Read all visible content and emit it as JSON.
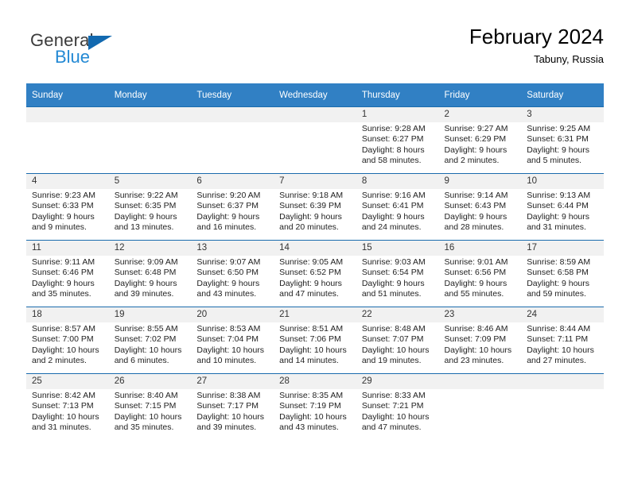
{
  "brand": {
    "name_part1": "General",
    "name_part2": "Blue",
    "triangle_color": "#1269b0",
    "blue_color": "#2389d4"
  },
  "header": {
    "title": "February 2024",
    "subtitle": "Tabuny, Russia"
  },
  "theme": {
    "header_blue": "#3180c4",
    "separator_blue": "#1a6bad",
    "daynum_band": "#f1f1f1"
  },
  "columns": [
    "Sunday",
    "Monday",
    "Tuesday",
    "Wednesday",
    "Thursday",
    "Friday",
    "Saturday"
  ],
  "weeks": [
    [
      {
        "day": "",
        "lines": []
      },
      {
        "day": "",
        "lines": []
      },
      {
        "day": "",
        "lines": []
      },
      {
        "day": "",
        "lines": []
      },
      {
        "day": "1",
        "lines": [
          "Sunrise: 9:28 AM",
          "Sunset: 6:27 PM",
          "Daylight: 8 hours",
          "and 58 minutes."
        ]
      },
      {
        "day": "2",
        "lines": [
          "Sunrise: 9:27 AM",
          "Sunset: 6:29 PM",
          "Daylight: 9 hours",
          "and 2 minutes."
        ]
      },
      {
        "day": "3",
        "lines": [
          "Sunrise: 9:25 AM",
          "Sunset: 6:31 PM",
          "Daylight: 9 hours",
          "and 5 minutes."
        ]
      }
    ],
    [
      {
        "day": "4",
        "lines": [
          "Sunrise: 9:23 AM",
          "Sunset: 6:33 PM",
          "Daylight: 9 hours",
          "and 9 minutes."
        ]
      },
      {
        "day": "5",
        "lines": [
          "Sunrise: 9:22 AM",
          "Sunset: 6:35 PM",
          "Daylight: 9 hours",
          "and 13 minutes."
        ]
      },
      {
        "day": "6",
        "lines": [
          "Sunrise: 9:20 AM",
          "Sunset: 6:37 PM",
          "Daylight: 9 hours",
          "and 16 minutes."
        ]
      },
      {
        "day": "7",
        "lines": [
          "Sunrise: 9:18 AM",
          "Sunset: 6:39 PM",
          "Daylight: 9 hours",
          "and 20 minutes."
        ]
      },
      {
        "day": "8",
        "lines": [
          "Sunrise: 9:16 AM",
          "Sunset: 6:41 PM",
          "Daylight: 9 hours",
          "and 24 minutes."
        ]
      },
      {
        "day": "9",
        "lines": [
          "Sunrise: 9:14 AM",
          "Sunset: 6:43 PM",
          "Daylight: 9 hours",
          "and 28 minutes."
        ]
      },
      {
        "day": "10",
        "lines": [
          "Sunrise: 9:13 AM",
          "Sunset: 6:44 PM",
          "Daylight: 9 hours",
          "and 31 minutes."
        ]
      }
    ],
    [
      {
        "day": "11",
        "lines": [
          "Sunrise: 9:11 AM",
          "Sunset: 6:46 PM",
          "Daylight: 9 hours",
          "and 35 minutes."
        ]
      },
      {
        "day": "12",
        "lines": [
          "Sunrise: 9:09 AM",
          "Sunset: 6:48 PM",
          "Daylight: 9 hours",
          "and 39 minutes."
        ]
      },
      {
        "day": "13",
        "lines": [
          "Sunrise: 9:07 AM",
          "Sunset: 6:50 PM",
          "Daylight: 9 hours",
          "and 43 minutes."
        ]
      },
      {
        "day": "14",
        "lines": [
          "Sunrise: 9:05 AM",
          "Sunset: 6:52 PM",
          "Daylight: 9 hours",
          "and 47 minutes."
        ]
      },
      {
        "day": "15",
        "lines": [
          "Sunrise: 9:03 AM",
          "Sunset: 6:54 PM",
          "Daylight: 9 hours",
          "and 51 minutes."
        ]
      },
      {
        "day": "16",
        "lines": [
          "Sunrise: 9:01 AM",
          "Sunset: 6:56 PM",
          "Daylight: 9 hours",
          "and 55 minutes."
        ]
      },
      {
        "day": "17",
        "lines": [
          "Sunrise: 8:59 AM",
          "Sunset: 6:58 PM",
          "Daylight: 9 hours",
          "and 59 minutes."
        ]
      }
    ],
    [
      {
        "day": "18",
        "lines": [
          "Sunrise: 8:57 AM",
          "Sunset: 7:00 PM",
          "Daylight: 10 hours",
          "and 2 minutes."
        ]
      },
      {
        "day": "19",
        "lines": [
          "Sunrise: 8:55 AM",
          "Sunset: 7:02 PM",
          "Daylight: 10 hours",
          "and 6 minutes."
        ]
      },
      {
        "day": "20",
        "lines": [
          "Sunrise: 8:53 AM",
          "Sunset: 7:04 PM",
          "Daylight: 10 hours",
          "and 10 minutes."
        ]
      },
      {
        "day": "21",
        "lines": [
          "Sunrise: 8:51 AM",
          "Sunset: 7:06 PM",
          "Daylight: 10 hours",
          "and 14 minutes."
        ]
      },
      {
        "day": "22",
        "lines": [
          "Sunrise: 8:48 AM",
          "Sunset: 7:07 PM",
          "Daylight: 10 hours",
          "and 19 minutes."
        ]
      },
      {
        "day": "23",
        "lines": [
          "Sunrise: 8:46 AM",
          "Sunset: 7:09 PM",
          "Daylight: 10 hours",
          "and 23 minutes."
        ]
      },
      {
        "day": "24",
        "lines": [
          "Sunrise: 8:44 AM",
          "Sunset: 7:11 PM",
          "Daylight: 10 hours",
          "and 27 minutes."
        ]
      }
    ],
    [
      {
        "day": "25",
        "lines": [
          "Sunrise: 8:42 AM",
          "Sunset: 7:13 PM",
          "Daylight: 10 hours",
          "and 31 minutes."
        ]
      },
      {
        "day": "26",
        "lines": [
          "Sunrise: 8:40 AM",
          "Sunset: 7:15 PM",
          "Daylight: 10 hours",
          "and 35 minutes."
        ]
      },
      {
        "day": "27",
        "lines": [
          "Sunrise: 8:38 AM",
          "Sunset: 7:17 PM",
          "Daylight: 10 hours",
          "and 39 minutes."
        ]
      },
      {
        "day": "28",
        "lines": [
          "Sunrise: 8:35 AM",
          "Sunset: 7:19 PM",
          "Daylight: 10 hours",
          "and 43 minutes."
        ]
      },
      {
        "day": "29",
        "lines": [
          "Sunrise: 8:33 AM",
          "Sunset: 7:21 PM",
          "Daylight: 10 hours",
          "and 47 minutes."
        ]
      },
      {
        "day": "",
        "lines": []
      },
      {
        "day": "",
        "lines": []
      }
    ]
  ]
}
